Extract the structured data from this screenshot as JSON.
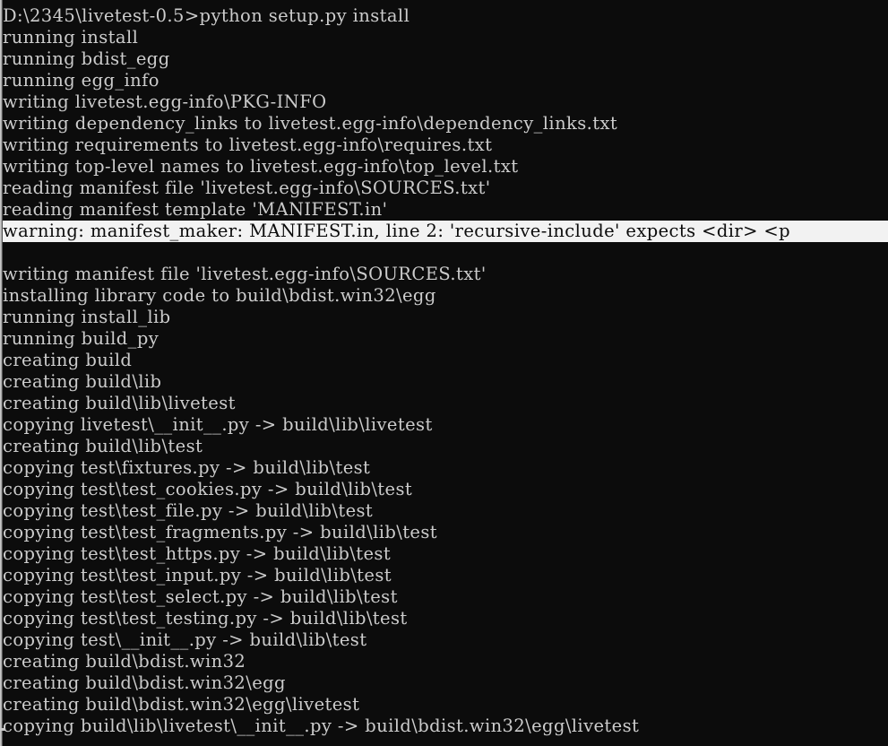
{
  "window": {
    "kind": "windows-command-prompt",
    "background_color": "#0c0c0c",
    "text_color": "#cccccc",
    "selection_background_color": "#f2f2f2",
    "selection_text_color": "#0c0c0c",
    "prompt_path": "D:\\2345\\livetest-0.5>",
    "command": "python setup.py install"
  },
  "console": {
    "lines": [
      {
        "text": "D:\\2345\\livetest-0.5>python setup.py install",
        "selected": false
      },
      {
        "text": "running install",
        "selected": false
      },
      {
        "text": "running bdist_egg",
        "selected": false
      },
      {
        "text": "running egg_info",
        "selected": false
      },
      {
        "text": "writing livetest.egg-info\\PKG-INFO",
        "selected": false
      },
      {
        "text": "writing dependency_links to livetest.egg-info\\dependency_links.txt",
        "selected": false
      },
      {
        "text": "writing requirements to livetest.egg-info\\requires.txt",
        "selected": false
      },
      {
        "text": "writing top-level names to livetest.egg-info\\top_level.txt",
        "selected": false
      },
      {
        "text": "reading manifest file 'livetest.egg-info\\SOURCES.txt'",
        "selected": false
      },
      {
        "text": "reading manifest template 'MANIFEST.in'",
        "selected": false
      },
      {
        "text": "warning: manifest_maker: MANIFEST.in, line 2: 'recursive-include' expects <dir> <p",
        "selected": true
      },
      {
        "text": "",
        "selected": false
      },
      {
        "text": "writing manifest file 'livetest.egg-info\\SOURCES.txt'",
        "selected": false
      },
      {
        "text": "installing library code to build\\bdist.win32\\egg",
        "selected": false
      },
      {
        "text": "running install_lib",
        "selected": false
      },
      {
        "text": "running build_py",
        "selected": false
      },
      {
        "text": "creating build",
        "selected": false
      },
      {
        "text": "creating build\\lib",
        "selected": false
      },
      {
        "text": "creating build\\lib\\livetest",
        "selected": false
      },
      {
        "text": "copying livetest\\__init__.py -> build\\lib\\livetest",
        "selected": false
      },
      {
        "text": "creating build\\lib\\test",
        "selected": false
      },
      {
        "text": "copying test\\fixtures.py -> build\\lib\\test",
        "selected": false
      },
      {
        "text": "copying test\\test_cookies.py -> build\\lib\\test",
        "selected": false
      },
      {
        "text": "copying test\\test_file.py -> build\\lib\\test",
        "selected": false
      },
      {
        "text": "copying test\\test_fragments.py -> build\\lib\\test",
        "selected": false
      },
      {
        "text": "copying test\\test_https.py -> build\\lib\\test",
        "selected": false
      },
      {
        "text": "copying test\\test_input.py -> build\\lib\\test",
        "selected": false
      },
      {
        "text": "copying test\\test_select.py -> build\\lib\\test",
        "selected": false
      },
      {
        "text": "copying test\\test_testing.py -> build\\lib\\test",
        "selected": false
      },
      {
        "text": "copying test\\__init__.py -> build\\lib\\test",
        "selected": false
      },
      {
        "text": "creating build\\bdist.win32",
        "selected": false
      },
      {
        "text": "creating build\\bdist.win32\\egg",
        "selected": false
      },
      {
        "text": "creating build\\bdist.win32\\egg\\livetest",
        "selected": false
      },
      {
        "text": "copying build\\lib\\livetest\\__init__.py -> build\\bdist.win32\\egg\\livetest",
        "selected": false
      }
    ]
  }
}
